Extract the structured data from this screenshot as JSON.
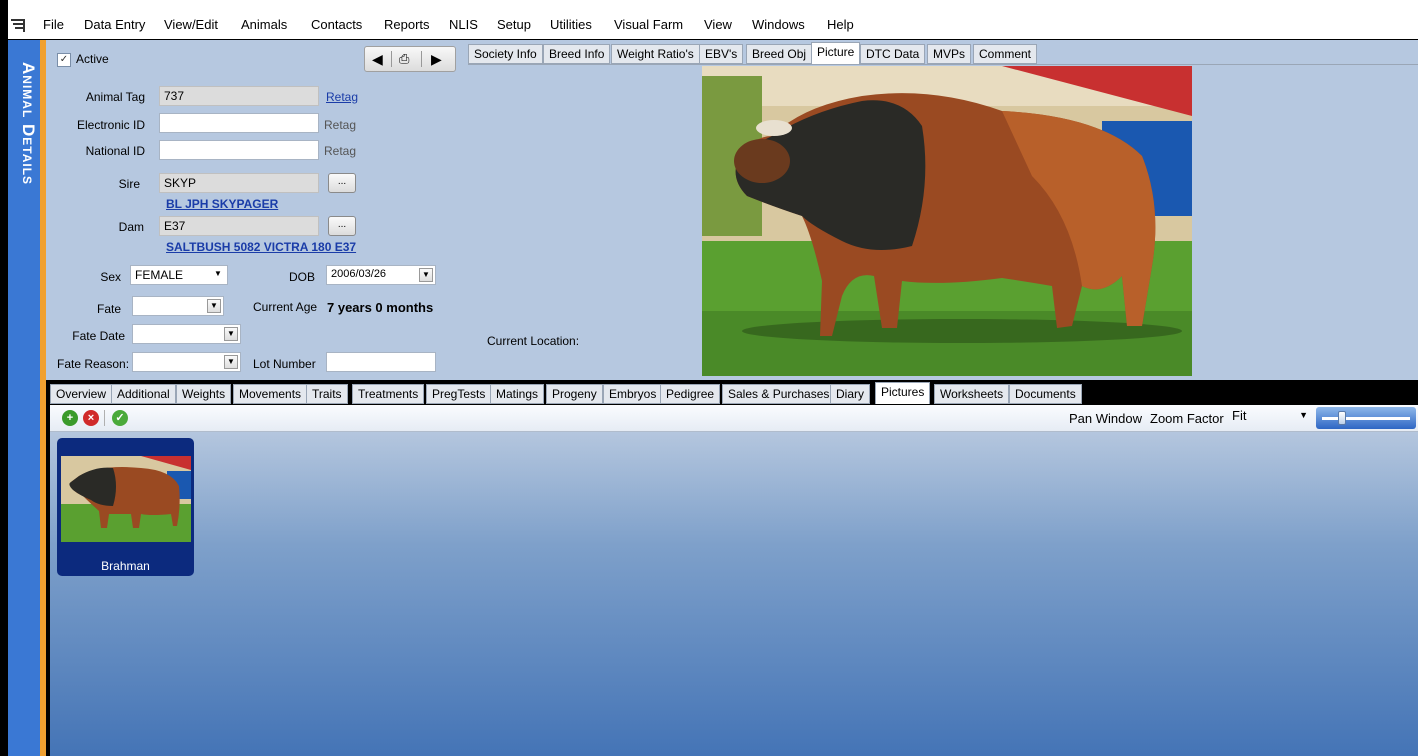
{
  "menu": [
    "File",
    "Data Entry",
    "View/Edit",
    "Animals",
    "Contacts",
    "Reports",
    "NLIS",
    "Setup",
    "Utilities",
    "Visual Farm",
    "View",
    "Windows",
    "Help"
  ],
  "sidebar": {
    "title": "Animal Details"
  },
  "form": {
    "active_label": "Active",
    "active_checked": true,
    "animal_tag_label": "Animal Tag",
    "animal_tag_value": "737",
    "retag_link": "Retag",
    "electronic_id_label": "Electronic ID",
    "electronic_id_value": "",
    "retag_eid": "Retag",
    "national_id_label": "National ID",
    "national_id_value": "",
    "retag_nid": "Retag",
    "sire_label": "Sire",
    "sire_value": "SKYP",
    "sire_name": "BL JPH SKYPAGER",
    "dam_label": "Dam",
    "dam_value": "E37",
    "dam_name": "SALTBUSH 5082 VICTRA 180 E37",
    "ellipsis": "...",
    "sex_label": "Sex",
    "sex_value": "FEMALE",
    "dob_label": "DOB",
    "dob_value": "2006/03/26",
    "fate_label": "Fate",
    "fate_value": "",
    "current_age_label": "Current Age",
    "current_age_value": "7 years 0 months",
    "fate_date_label": "Fate Date",
    "fate_reason_label": "Fate Reason:",
    "lot_number_label": "Lot Number",
    "lot_number_value": ""
  },
  "top_tabs": [
    "Society Info",
    "Breed Info",
    "Weight Ratio's",
    "EBV's",
    "Breed Obj",
    "Picture",
    "DTC Data",
    "MVPs",
    "Comment"
  ],
  "top_tab_active": "Picture",
  "picture_panel": {
    "current_location_label": "Current Location:"
  },
  "bottom_tabs": [
    "Overview",
    "Additional",
    "Weights",
    "Movements",
    "Traits",
    "Treatments",
    "PregTests",
    "Matings",
    "Progeny",
    "Embryos",
    "Pedigree",
    "Sales & Purchases",
    "Diary",
    "Pictures",
    "Worksheets",
    "Documents"
  ],
  "bottom_tab_active": "Pictures",
  "pictures_toolbar": {
    "pan_window_label": "Pan Window",
    "zoom_factor_label": "Zoom Factor",
    "zoom_value": "Fit",
    "zoom_slider_level": 0.2
  },
  "gallery": [
    {
      "caption": "Brahman"
    }
  ],
  "colors": {
    "sidebar": "#3a78d4",
    "accent_strip": "#f0a030",
    "panel_bg": "#b6c8e0",
    "link": "#1a3ca8",
    "thumb_card": "#0c2a7e"
  }
}
